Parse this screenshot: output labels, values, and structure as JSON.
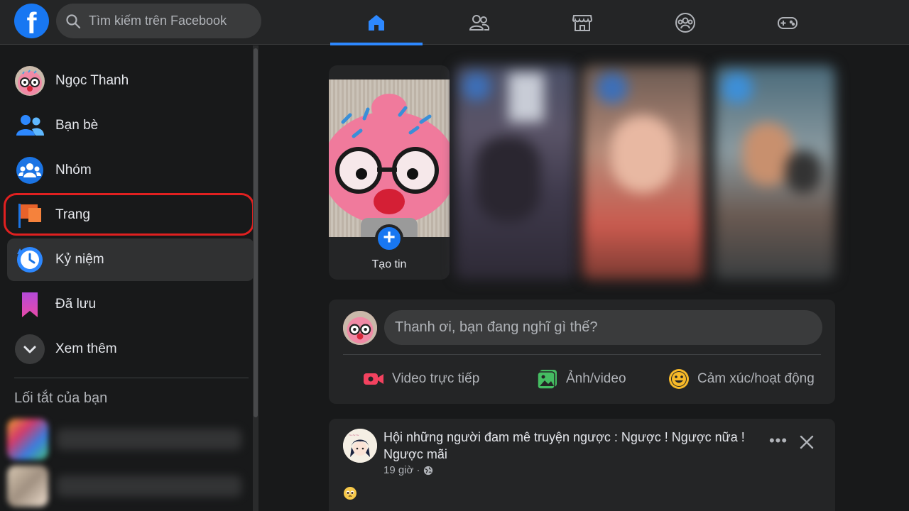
{
  "header": {
    "logo_letter": "f",
    "search_placeholder": "Tìm kiếm trên Facebook",
    "nav_tabs": [
      {
        "icon": "home-icon",
        "active": true
      },
      {
        "icon": "friends-icon",
        "active": false
      },
      {
        "icon": "marketplace-icon",
        "active": false
      },
      {
        "icon": "groups-icon",
        "active": false
      },
      {
        "icon": "gaming-icon",
        "active": false
      }
    ]
  },
  "sidebar": {
    "items": [
      {
        "label": "Ngọc Thanh",
        "icon": "user-avatar"
      },
      {
        "label": "Bạn bè",
        "icon": "friends-icon"
      },
      {
        "label": "Nhóm",
        "icon": "groups-icon"
      },
      {
        "label": "Trang",
        "icon": "flag-icon"
      },
      {
        "label": "Kỷ niệm",
        "icon": "memories-clock-icon"
      },
      {
        "label": "Đã lưu",
        "icon": "bookmark-icon"
      },
      {
        "label": "Xem thêm",
        "icon": "chevron-down-icon"
      }
    ],
    "shortcuts_title": "Lối tắt của bạn"
  },
  "stories": {
    "create_label": "Tạo tin"
  },
  "composer": {
    "placeholder": "Thanh ơi, bạn đang nghĩ gì thế?",
    "actions": [
      {
        "label": "Video trực tiếp",
        "icon": "live-video-icon",
        "color": "#f3425f"
      },
      {
        "label": "Ảnh/video",
        "icon": "photo-icon",
        "color": "#45bd62"
      },
      {
        "label": "Cảm xúc/hoạt động",
        "icon": "feeling-icon",
        "color": "#f7b928"
      }
    ]
  },
  "post": {
    "group_name": "Hội những người đam mê truyện ngược : Ngược ! Ngược nữa ! Ngược mãi",
    "time": "19 giờ ·",
    "more_label": "•••"
  },
  "colors": {
    "accent": "#2d88ff",
    "highlight_ring": "#e02020",
    "background": "#18191a",
    "surface": "#242526"
  }
}
